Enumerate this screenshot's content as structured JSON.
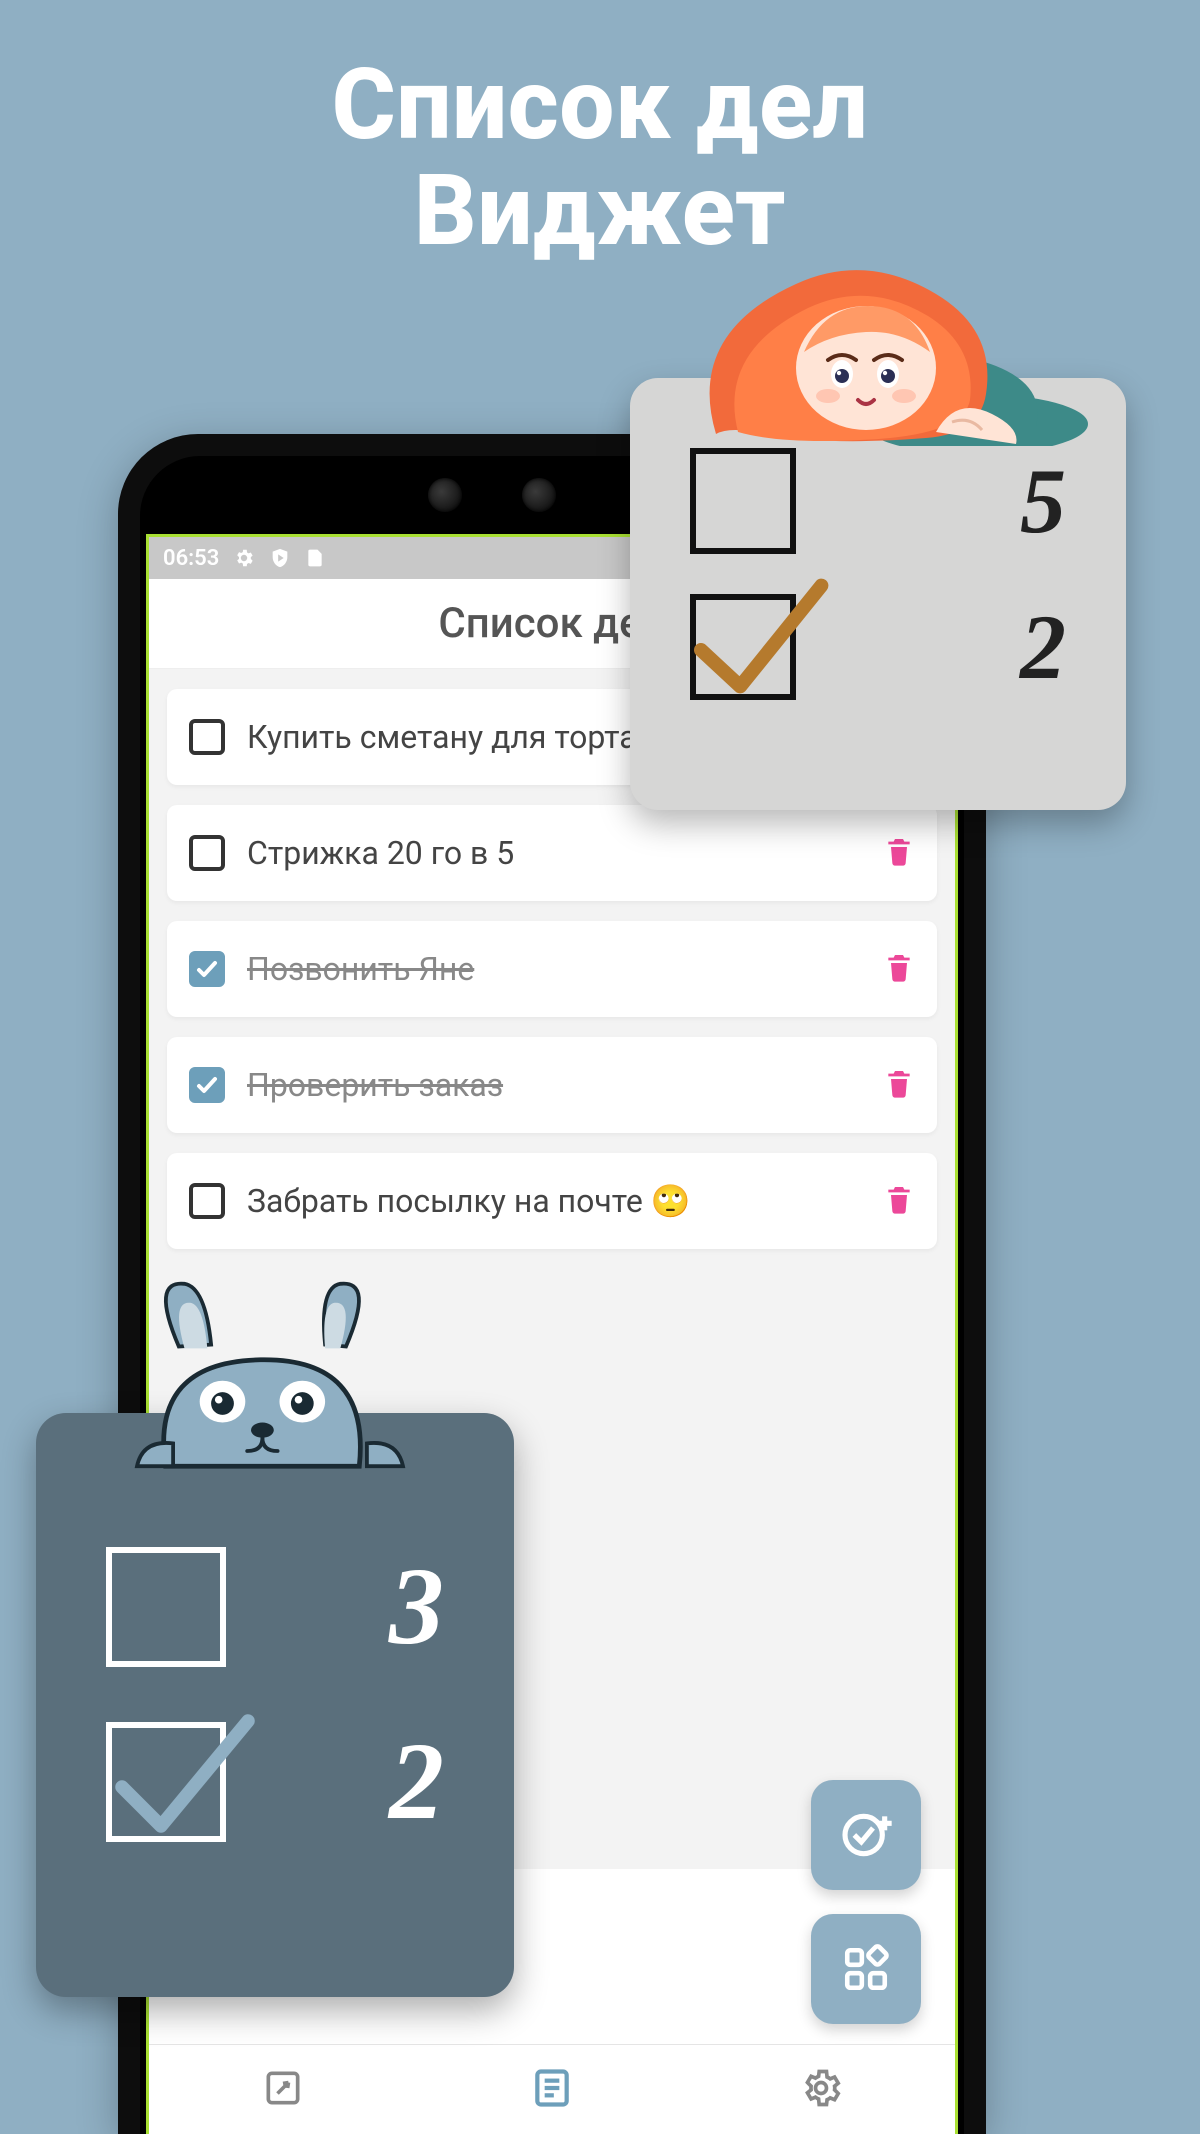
{
  "hero": {
    "line1": "Список дел",
    "line2": "Виджет"
  },
  "statusbar": {
    "time": "06:53"
  },
  "app": {
    "title": "Список дел"
  },
  "tasks": [
    {
      "label": "Купить сметану для торта",
      "done": false
    },
    {
      "label": "Стрижка 20 го в 5",
      "done": false
    },
    {
      "label": "Позвонить Яне",
      "done": true
    },
    {
      "label": "Проверить заказ",
      "done": true
    },
    {
      "label": "Забрать посылку на почте 🙄",
      "done": false
    }
  ],
  "widget_light": {
    "unchecked_count": "5",
    "checked_count": "2"
  },
  "widget_dark": {
    "unchecked_count": "3",
    "checked_count": "2"
  },
  "colors": {
    "bg": "#8fafc3",
    "accent": "#6d9fba",
    "trash": "#ec4899",
    "dark_widget": "#5a6f7c",
    "light_widget": "#d6d6d5"
  }
}
